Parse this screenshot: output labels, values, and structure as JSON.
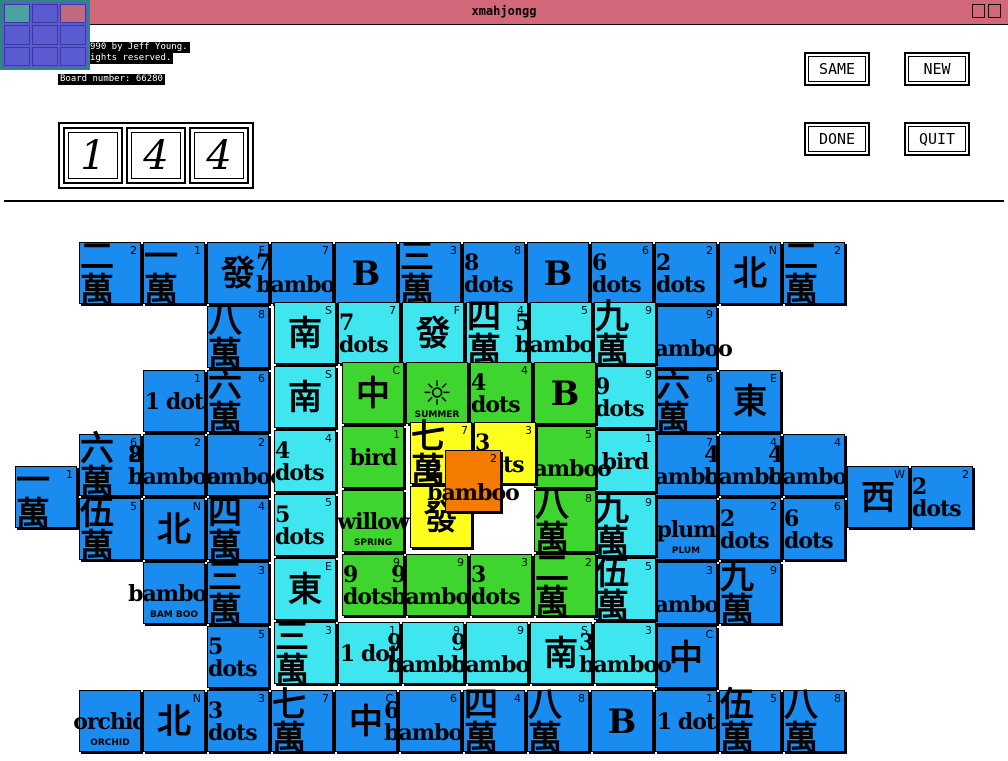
{
  "window": {
    "title": "xmahjongg"
  },
  "header": {
    "copyright_1": "990 by Jeff Young.",
    "copyright_2": "ights reserved.",
    "board_number": "Board number: 66280",
    "tiles_left": [
      "1",
      "4",
      "4"
    ],
    "buttons": {
      "same": "SAME",
      "new": "NEW",
      "done": "DONE",
      "quit": "QUIT"
    }
  },
  "colors": {
    "layer1": "#1a8cf0",
    "layer2": "#3fe6f0",
    "layer3": "#3ed62e",
    "layer4": "#ffff1e",
    "layer5": "#f57a00",
    "titlebar": "#d3677a"
  },
  "tiles": [
    {
      "g": "二萬",
      "n": "2"
    },
    {
      "g": "一萬",
      "n": "1"
    },
    {
      "g": "發",
      "n": "F"
    },
    {
      "g": "7 bamboo",
      "n": "7",
      "icon": "bamboo-icon"
    },
    {
      "g": "B",
      "n": "",
      "icon": "blank-icon"
    },
    {
      "g": "三萬",
      "n": "3"
    },
    {
      "g": "8 dots",
      "n": "8",
      "icon": "dots-icon"
    },
    {
      "g": "B",
      "n": "",
      "icon": "blank-icon"
    },
    {
      "g": "6 dots",
      "n": "6",
      "icon": "dots-icon"
    },
    {
      "g": "2 dots",
      "n": "2",
      "icon": "dots-icon"
    },
    {
      "g": "北",
      "n": "N"
    },
    {
      "g": "二萬",
      "n": "2"
    },
    {
      "g": "八萬",
      "n": "8"
    },
    {
      "g": "南",
      "n": "S"
    },
    {
      "g": "7 dots",
      "n": "7",
      "icon": "dots-icon"
    },
    {
      "g": "發",
      "n": "F"
    },
    {
      "g": "四萬",
      "n": "4"
    },
    {
      "g": "5 bamboo",
      "n": "5",
      "icon": "bamboo-icon"
    },
    {
      "g": "九萬",
      "n": "9"
    },
    {
      "g": "9 bamboo",
      "n": "9",
      "icon": "bamboo-icon"
    },
    {
      "g": "1 dot",
      "n": "1",
      "icon": "dots-icon"
    },
    {
      "g": "六萬",
      "n": "6"
    },
    {
      "g": "南",
      "n": "S"
    },
    {
      "g": "中",
      "n": "C"
    },
    {
      "g": "☼",
      "n": "",
      "cap": "SUMMER",
      "icon": "sun-icon"
    },
    {
      "g": "4 dots",
      "n": "4",
      "icon": "dots-icon"
    },
    {
      "g": "B",
      "n": "",
      "icon": "blank-icon"
    },
    {
      "g": "9 dots",
      "n": "9",
      "icon": "dots-icon"
    },
    {
      "g": "六萬",
      "n": "6"
    },
    {
      "g": "東",
      "n": "E"
    },
    {
      "g": "六萬",
      "n": "6"
    },
    {
      "g": "8 bamboo",
      "n": "8",
      "icon": "bamboo-icon"
    },
    {
      "g": "2 bamboo",
      "n": "2",
      "icon": "bamboo-icon"
    },
    {
      "g": "4 dots",
      "n": "4",
      "icon": "dots-icon"
    },
    {
      "g": "bird",
      "n": "1",
      "icon": "bird-icon"
    },
    {
      "g": "七萬",
      "n": "7"
    },
    {
      "g": "3 dots",
      "n": "3",
      "icon": "dots-icon"
    },
    {
      "g": "5 bamboo",
      "n": "5",
      "icon": "bamboo-icon"
    },
    {
      "g": "bird",
      "n": "1",
      "icon": "bird-icon"
    },
    {
      "g": "7 bamboo",
      "n": "7",
      "icon": "bamboo-icon"
    },
    {
      "g": "4 bamboo",
      "n": "4",
      "icon": "bamboo-icon"
    },
    {
      "g": "4 bamboo",
      "n": "4",
      "icon": "bamboo-icon"
    },
    {
      "g": "一萬",
      "n": "1"
    },
    {
      "g": "2 bamboo",
      "n": "2",
      "icon": "bamboo-icon"
    },
    {
      "g": "西",
      "n": "W"
    },
    {
      "g": "2 dots",
      "n": "2",
      "icon": "dots-icon"
    },
    {
      "g": "伍萬",
      "n": "5"
    },
    {
      "g": "北",
      "n": "N"
    },
    {
      "g": "四萬",
      "n": "4"
    },
    {
      "g": "5 dots",
      "n": "5",
      "icon": "dots-icon"
    },
    {
      "g": "willow",
      "n": "",
      "cap": "SPRING",
      "icon": "willow-icon"
    },
    {
      "g": "發",
      "n": ""
    },
    {
      "g": "八萬",
      "n": "8"
    },
    {
      "g": "九萬",
      "n": "9"
    },
    {
      "g": "plum",
      "n": "",
      "cap": "PLUM",
      "icon": "plum-icon"
    },
    {
      "g": "2 dots",
      "n": "2",
      "icon": "dots-icon"
    },
    {
      "g": "6 dots",
      "n": "6",
      "icon": "dots-icon"
    },
    {
      "g": "bamboo",
      "n": "",
      "cap": "BAM BOO",
      "icon": "bamboo-flower-icon"
    },
    {
      "g": "三萬",
      "n": "3"
    },
    {
      "g": "東",
      "n": "E"
    },
    {
      "g": "9 dots",
      "n": "9",
      "icon": "dots-icon"
    },
    {
      "g": "9 bamboo",
      "n": "9",
      "icon": "bamboo-icon"
    },
    {
      "g": "3 dots",
      "n": "3",
      "icon": "dots-icon"
    },
    {
      "g": "二萬",
      "n": "2"
    },
    {
      "g": "伍萬",
      "n": "5"
    },
    {
      "g": "3 bamboo",
      "n": "3",
      "icon": "bamboo-icon"
    },
    {
      "g": "九萬",
      "n": "9"
    },
    {
      "g": "5 dots",
      "n": "5",
      "icon": "dots-icon"
    },
    {
      "g": "三萬",
      "n": "3"
    },
    {
      "g": "1 dot",
      "n": "1",
      "icon": "dots-icon"
    },
    {
      "g": "9 bamboo",
      "n": "9",
      "icon": "bamboo-icon"
    },
    {
      "g": "9 bamboo",
      "n": "9",
      "icon": "bamboo-icon"
    },
    {
      "g": "南",
      "n": "S"
    },
    {
      "g": "3 bamboo",
      "n": "3",
      "icon": "bamboo-icon"
    },
    {
      "g": "中",
      "n": "C"
    },
    {
      "g": "orchid",
      "n": "",
      "cap": "ORCHID",
      "icon": "orchid-icon"
    },
    {
      "g": "北",
      "n": "N"
    },
    {
      "g": "3 dots",
      "n": "3",
      "icon": "dots-icon"
    },
    {
      "g": "七萬",
      "n": "7"
    },
    {
      "g": "中",
      "n": "C"
    },
    {
      "g": "6 bamboo",
      "n": "6",
      "icon": "bamboo-icon"
    },
    {
      "g": "四萬",
      "n": "4"
    },
    {
      "g": "八萬",
      "n": "8"
    },
    {
      "g": "B",
      "n": "",
      "icon": "blank-icon"
    },
    {
      "g": "1 dot",
      "n": "1",
      "icon": "dots-icon"
    },
    {
      "g": "伍萬",
      "n": "5"
    },
    {
      "g": "八萬",
      "n": "8"
    },
    {
      "g": "2 bamboo",
      "n": "2",
      "icon": "bamboo-icon"
    }
  ]
}
